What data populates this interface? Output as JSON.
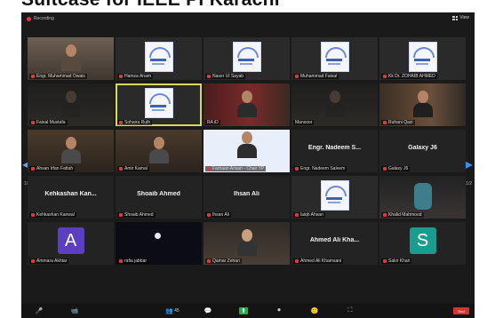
{
  "banner": {
    "text": "Suitcase for IEEE PI Karachi"
  },
  "topbar": {
    "recording_label": "Recording",
    "view_label": "View"
  },
  "navigation": {
    "page_left": "1/2",
    "page_right": "1/2"
  },
  "tiles": [
    {
      "name": "Engr. Muhammad Owais",
      "kind": "video-room",
      "muted": true
    },
    {
      "name": "Hamza Anam",
      "kind": "logo",
      "muted": true
    },
    {
      "name": "Naser Ul Sayab",
      "kind": "logo",
      "muted": true
    },
    {
      "name": "Muhammad Faisal",
      "kind": "logo",
      "muted": true
    },
    {
      "name": "Kk Dr. ZOHAIB AHMED",
      "kind": "logo",
      "muted": true
    },
    {
      "name": "Faisal Mustafa",
      "kind": "video-dark",
      "muted": true
    },
    {
      "name": "Sohaira Ruth",
      "kind": "logo",
      "muted": true,
      "active": true
    },
    {
      "name": "RA iD",
      "kind": "video-red",
      "muted": false
    },
    {
      "name": "Mansoor",
      "kind": "video-dark",
      "muted": false
    },
    {
      "name": "Ruhani Qazi",
      "kind": "video-shelf",
      "muted": true
    },
    {
      "name": "Ahsan Irfan Fattah",
      "kind": "video-brown",
      "muted": true
    },
    {
      "name": "Amir Kamal",
      "kind": "video-brown",
      "muted": true
    },
    {
      "name": "Farhaan Ansari - Chair YP",
      "kind": "slide",
      "muted": true
    },
    {
      "name": "Engr. Nadeem Saleem",
      "kind": "name-only",
      "big_name": "Engr. Nadeem S...",
      "muted": true
    },
    {
      "name": "Galaxy J6",
      "kind": "name-only",
      "big_name": "Galaxy J6",
      "muted": true
    },
    {
      "name": "Kehkashan Kanwal",
      "kind": "name-only",
      "big_name": "Kehkashan Kan...",
      "muted": true
    },
    {
      "name": "Shoaib Ahmed",
      "kind": "name-only",
      "big_name": "Shoaib Ahmed",
      "muted": true
    },
    {
      "name": "Ihsan Ali",
      "kind": "name-only",
      "big_name": "Ihsan Ali",
      "muted": true
    },
    {
      "name": "laiqh Ahsan",
      "kind": "logo",
      "muted": true
    },
    {
      "name": "Khalid Mahmood",
      "kind": "video-mask",
      "muted": true
    },
    {
      "name": "Ammara Akhtar",
      "kind": "avatar",
      "letter": "A",
      "avatar_color": "#5b3ec2",
      "muted": true
    },
    {
      "name": "rafia jabbar",
      "kind": "night",
      "muted": true
    },
    {
      "name": "Qamar Zehan",
      "kind": "video-photo",
      "muted": true
    },
    {
      "name": "Ahmed Ali Khamsani",
      "kind": "name-only",
      "big_name": "Ahmed Ali Kha...",
      "muted": true
    },
    {
      "name": "Sakir Khan",
      "kind": "avatar",
      "letter": "S",
      "avatar_color": "#1a9c8e",
      "muted": true
    }
  ],
  "toolbar": {
    "unmute": "🎤",
    "video": "📹",
    "participants": "👥",
    "participants_count": "45",
    "chat": "💬",
    "share": "⬆",
    "record": "⏺",
    "reactions": "🙂",
    "apps": "⛶",
    "end_label": "End"
  },
  "colors": {
    "active_speaker_outline": "#d8d85a",
    "muted_icon": "#e23838",
    "end_button": "#d9342b"
  }
}
